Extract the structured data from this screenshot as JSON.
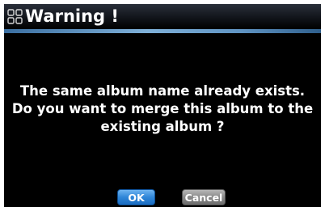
{
  "dialog": {
    "title": "Warning !",
    "title_icon": "grid-icon",
    "message_lines": [
      "The same album name already exists.",
      "Do you want to merge this album to the",
      "existing album ?"
    ],
    "buttons": {
      "ok_label": "OK",
      "cancel_label": "Cancel"
    }
  },
  "colors": {
    "background": "#000000",
    "accent_line": "#7fb0d8",
    "ok_button": "#2f86d8",
    "cancel_button": "#8a8a8a",
    "text": "#ffffff"
  }
}
